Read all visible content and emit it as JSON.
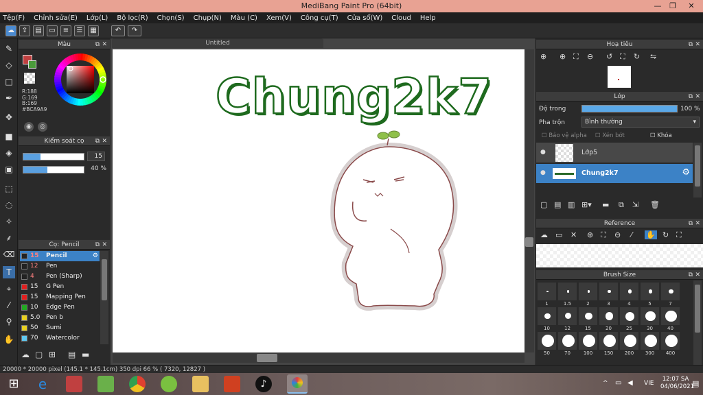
{
  "app": {
    "title": "MediBang Paint Pro (64bit)"
  },
  "menu": [
    "Tệp(F)",
    "Chỉnh sửa(E)",
    "Lớp(L)",
    "Bộ lọc(R)",
    "Chọn(S)",
    "Chụp(N)",
    "Màu (C)",
    "Xem(V)",
    "Công cụ(T)",
    "Cửa sổ(W)",
    "Cloud",
    "Help"
  ],
  "color_panel": {
    "title": "Màu",
    "r": "R:188",
    "g": "G:169",
    "b": "B:169",
    "hex": "#BCA9A9",
    "primary": "#bca9a9"
  },
  "control_panel": {
    "title": "Kiểm soát cọ",
    "size_value": "15",
    "opacity_value": "40 %"
  },
  "brush_panel": {
    "title": "Cọ: Pencil",
    "items": [
      {
        "size": "15",
        "name": "Pencil",
        "color": "#222222",
        "selected": true
      },
      {
        "size": "12",
        "name": "Pen",
        "color": "#222222"
      },
      {
        "size": "4",
        "name": "Pen (Sharp)",
        "color": "#222222"
      },
      {
        "size": "15",
        "name": "G Pen",
        "color": "#e02020"
      },
      {
        "size": "15",
        "name": "Mapping Pen",
        "color": "#e02020"
      },
      {
        "size": "10",
        "name": "Edge Pen",
        "color": "#22aa22"
      },
      {
        "size": "5.0",
        "name": "Pen b",
        "color": "#e8d020"
      },
      {
        "size": "50",
        "name": "Sumi",
        "color": "#e8d020"
      },
      {
        "size": "70",
        "name": "Watercolor",
        "color": "#60c8f0"
      }
    ]
  },
  "document": {
    "tab": "Untitled",
    "canvas_text": "Chung2k7"
  },
  "navigator": {
    "title": "Hoạ tiêu"
  },
  "layer_panel": {
    "title": "Lớp",
    "opacity_label": "Độ trong",
    "opacity_value": "100 %",
    "blend_label": "Pha trộn",
    "blend_value": "Bình thường",
    "protect_alpha": "Bảo vệ alpha",
    "clipping": "Xén bớt",
    "lock": "Khóa",
    "layers": [
      {
        "name": "Lớp5",
        "selected": false
      },
      {
        "name": "Chung2k7",
        "selected": true
      }
    ]
  },
  "reference_panel": {
    "title": "Reference"
  },
  "brush_size_panel": {
    "title": "Brush Size",
    "sizes": [
      "1",
      "1.5",
      "2",
      "3",
      "4",
      "5",
      "7",
      "10",
      "12",
      "15",
      "20",
      "25",
      "30",
      "40",
      "50",
      "70",
      "100",
      "150",
      "200",
      "300",
      "400"
    ]
  },
  "status": {
    "text": "20000 * 20000 pixel  (145.1 * 145.1cm)  350 dpi  66 %  ( 7320, 12827 )"
  },
  "taskbar": {
    "lang": "VIE",
    "time": "12:07 SA",
    "date": "04/06/2021"
  }
}
